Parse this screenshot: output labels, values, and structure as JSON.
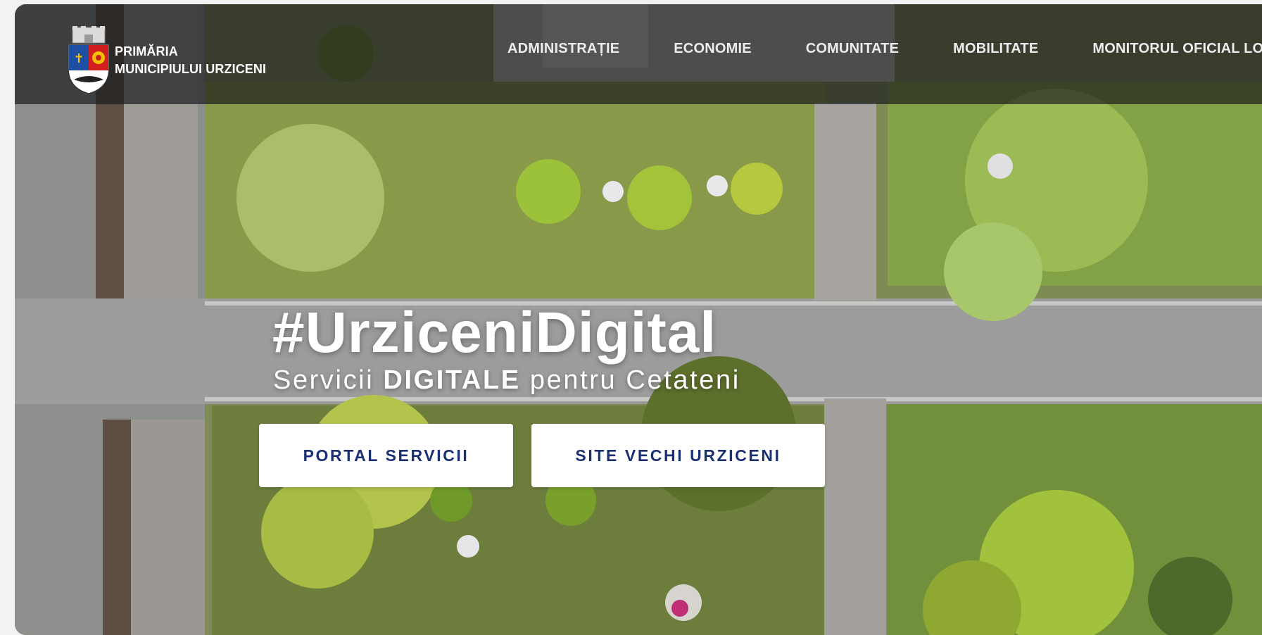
{
  "brand": {
    "line1": "PRIMĂRIA",
    "line2": "MUNICIPIULUI URZICENI"
  },
  "nav": {
    "items": [
      {
        "label": "ADMINISTRAȚIE"
      },
      {
        "label": "ECONOMIE"
      },
      {
        "label": "COMUNITATE"
      },
      {
        "label": "MOBILITATE"
      },
      {
        "label": "MONITORUL OFICIAL LOCAL"
      }
    ]
  },
  "hero": {
    "title": "#UrziceniDigital",
    "subtitle_prefix": "Servicii ",
    "subtitle_bold": "DIGITALE",
    "subtitle_suffix": " pentru Cetateni"
  },
  "buttons": {
    "portal": "PORTAL SERVICII",
    "old_site": "SITE VECHI URZICENI"
  },
  "icons": {
    "crest": "coat-of-arms-icon"
  },
  "colors": {
    "button_text": "#1b2f73",
    "navbar_bg": "rgba(20,22,24,0.66)"
  }
}
